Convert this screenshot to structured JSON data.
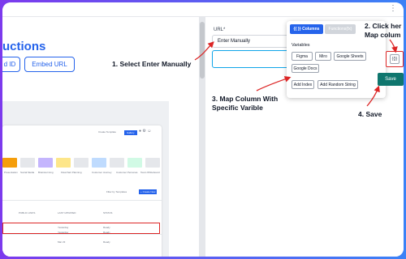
{
  "left": {
    "title": "uctions",
    "btn_id": "d ID",
    "btn_embed": "Embed URL"
  },
  "annotations": {
    "step1": "1. Select Enter Manually",
    "step2_line1": "2. Click her",
    "step2_line2": "Map colum",
    "step3_line1": "3. Map Column With",
    "step3_line2": "Specific Varible",
    "step4": "4. Save"
  },
  "form": {
    "url_label": "URL*",
    "url_mode": "Enter Manually",
    "var_icon": "{{}}",
    "save_label": "Save"
  },
  "popover": {
    "tab_columns": "{{ }} Columns",
    "tab_functions": "Functions(fx)",
    "variables_label": "Variables",
    "chips": [
      "Figma",
      "Miro",
      "Google Sheets",
      "Google Docs"
    ],
    "actions": [
      "Add Index",
      "Add Random String"
    ]
  },
  "preview": {
    "top_btn": "Create Template",
    "tag": "Gallery",
    "labels": [
      "Presentation",
      "Social Media",
      "Brainstorming",
      "Flowchart Planning",
      "Customer Journey",
      "Customer Personas",
      "Team Whiteboard"
    ],
    "filter_btn": "Filter by Templates",
    "new_btn": "+ Create New",
    "columns": [
      "PUBLIC LINKS",
      "LAST UPDATED",
      "STATUS"
    ],
    "rows": [
      {
        "date": "Yesterday",
        "status": "Ready"
      },
      {
        "date": "Yesterday",
        "status": "Ready"
      },
      {
        "date": "Mar 23",
        "status": "Ready"
      }
    ]
  },
  "colors": {
    "accent": "#2563eb",
    "annotation_red": "#dc2626",
    "save_teal": "#0f766e",
    "input_focus": "#0ea5e9"
  }
}
